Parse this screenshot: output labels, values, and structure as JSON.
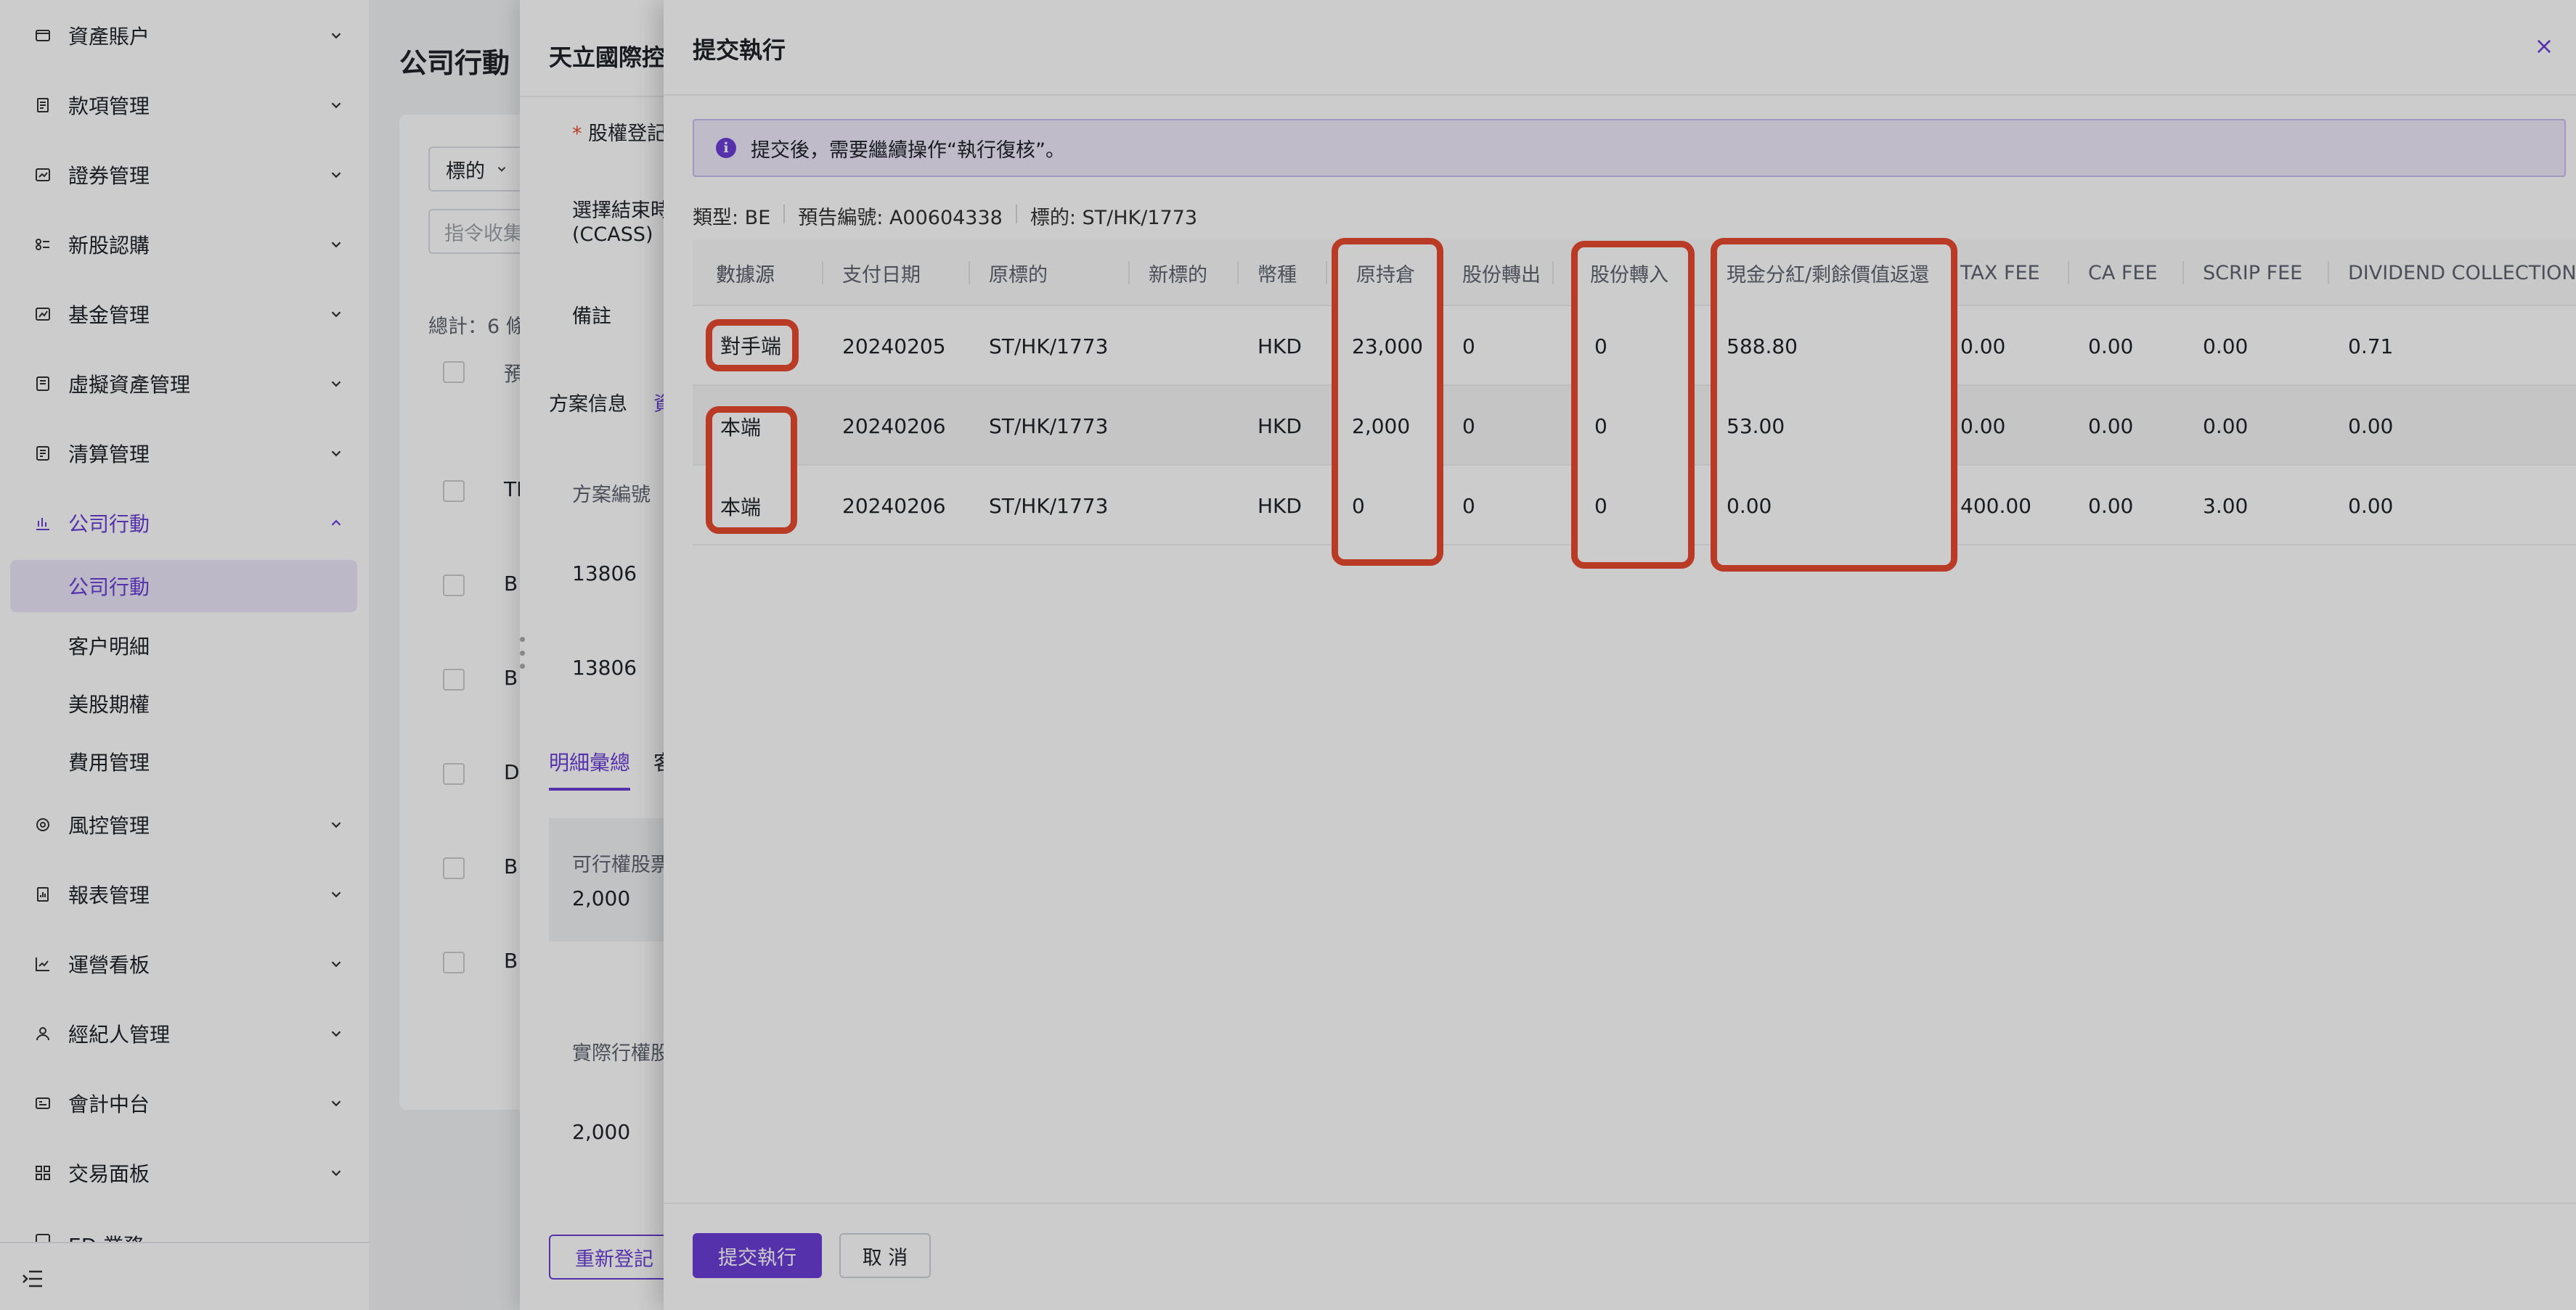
{
  "sidebar": {
    "menu": [
      {
        "label": "資產賬户",
        "icon": "wallet-icon"
      },
      {
        "label": "款項管理",
        "icon": "document-list-icon"
      },
      {
        "label": "證券管理",
        "icon": "securities-icon"
      },
      {
        "label": "新股認購",
        "icon": "ipo-icon"
      },
      {
        "label": "基金管理",
        "icon": "fund-chart-icon"
      },
      {
        "label": "虛擬資產管理",
        "icon": "virtual-asset-icon"
      },
      {
        "label": "清算管理",
        "icon": "settlement-icon"
      },
      {
        "label": "公司行動",
        "icon": "bar-chart-icon"
      },
      {
        "label": "風控管理",
        "icon": "risk-icon"
      },
      {
        "label": "報表管理",
        "icon": "report-icon"
      },
      {
        "label": "運營看板",
        "icon": "line-chart-icon"
      },
      {
        "label": "經紀人管理",
        "icon": "user-icon"
      },
      {
        "label": "會計中台",
        "icon": "accounting-icon"
      },
      {
        "label": "交易面板",
        "icon": "grid-icon"
      },
      {
        "label": "ED 業務",
        "icon": "ed-icon"
      }
    ],
    "submenu": [
      {
        "label": "公司行動"
      },
      {
        "label": "客户明細"
      },
      {
        "label": "美股期權"
      },
      {
        "label": "費用管理"
      }
    ]
  },
  "main": {
    "title": "公司行動",
    "filter_label": "標的",
    "search_placeholder": "指令收集",
    "total_label": "總計：6 條",
    "col_header": "預",
    "row_codes": [
      "TM",
      "BE",
      "BE",
      "DS",
      "BE",
      "BE"
    ]
  },
  "drawer1": {
    "title": "天立國際控",
    "field_equity": "股權登記",
    "field_end": "選擇結束時",
    "field_ccass": "(CCASS)",
    "field_note": "備註",
    "tab_scheme": "方案信息",
    "tab_second": "資",
    "scheme_no_label": "方案編號",
    "scheme_no_1": "13806",
    "scheme_no_2": "13806",
    "tab_detail": "明細彙總",
    "tab_client": "客",
    "exercisable_label": "可行權股票",
    "exercisable_value": "2,000",
    "actual_label": "實際行權股",
    "actual_value": "2,000",
    "reregister_button": "重新登記"
  },
  "drawer2": {
    "title": "提交執行",
    "alert": "提交後，需要繼續操作“執行復核”。",
    "meta_type": "類型: BE",
    "meta_notice": "預告編號: A00604338",
    "meta_symbol": "標的: ST/HK/1773",
    "columns": [
      "數據源",
      "支付日期",
      "原標的",
      "新標的",
      "幣種",
      "原持倉",
      "股份轉出",
      "股份轉入",
      "現金分紅/剩餘價值返還",
      "TAX FEE",
      "CA FEE",
      "SCRIP FEE",
      "DIVIDEND COLLECTION"
    ],
    "rows": [
      [
        "對手端",
        "20240205",
        "ST/HK/1773",
        "",
        "HKD",
        "23,000",
        "0",
        "0",
        "588.80",
        "0.00",
        "0.00",
        "0.00",
        "0.71"
      ],
      [
        "本端",
        "20240206",
        "ST/HK/1773",
        "",
        "HKD",
        "2,000",
        "0",
        "0",
        "53.00",
        "0.00",
        "0.00",
        "0.00",
        "0.00"
      ],
      [
        "本端",
        "20240206",
        "ST/HK/1773",
        "",
        "HKD",
        "0",
        "0",
        "0",
        "0.00",
        "400.00",
        "0.00",
        "3.00",
        "0.00"
      ]
    ],
    "submit_button": "提交執行",
    "cancel_button": "取 消"
  },
  "colors": {
    "accent": "#6b3fd6",
    "highlight": "#e94a2f"
  }
}
